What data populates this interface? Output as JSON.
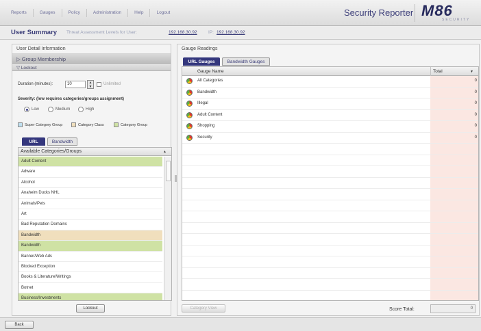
{
  "nav": {
    "items": [
      "Reports",
      "Gauges",
      "Policy",
      "Administration",
      "Help",
      "Logout"
    ],
    "brand": "Security Reporter",
    "logo_main": "M86",
    "logo_sub": "SECURITY"
  },
  "titlebar": {
    "title": "User Summary",
    "subtitle": "Threat Assessment Levels for User:",
    "user_ip": "192.168.30.92",
    "ip_label": "IP:",
    "ip": "192.168.30.92"
  },
  "left_panel": {
    "header": "User Detail Information",
    "group_membership": "Group Membership",
    "lockout": "Lockout",
    "duration_label": "Duration (minutes):",
    "duration_value": "10",
    "unlimited_label": "Unlimited",
    "severity_label": "Severity: (low requires categories/groups assignment)",
    "severity_options": [
      "Low",
      "Medium",
      "High"
    ],
    "severity_selected": "Low",
    "legend": [
      "Super Category Group",
      "Category Class",
      "Category Group"
    ],
    "legend_colors": [
      "#bfe0f0",
      "#f0dfbd",
      "#cfe2a4"
    ],
    "tabs": [
      "URL",
      "Bandwidth"
    ],
    "active_tab": "URL",
    "list_header": "Available Categories/Groups",
    "categories": [
      {
        "name": "Adult Content",
        "type": "group"
      },
      {
        "name": "Adware",
        "type": "none"
      },
      {
        "name": "Alcohol",
        "type": "none"
      },
      {
        "name": "Anaheim Ducks NHL",
        "type": "none"
      },
      {
        "name": "Animals/Pets",
        "type": "none"
      },
      {
        "name": "Art",
        "type": "none"
      },
      {
        "name": "Bad Reputation Domains",
        "type": "none"
      },
      {
        "name": "Bandwidth",
        "type": "class"
      },
      {
        "name": "Bandwidth",
        "type": "group"
      },
      {
        "name": "Banner/Web Ads",
        "type": "none"
      },
      {
        "name": "Blocked Exception",
        "type": "none"
      },
      {
        "name": "Books & Literature/Writings",
        "type": "none"
      },
      {
        "name": "Botnet",
        "type": "none"
      },
      {
        "name": "Business/Investments",
        "type": "group"
      }
    ],
    "lockout_button": "Lockout"
  },
  "right_panel": {
    "header": "Gauge Readings",
    "tabs": [
      "URL Gauges",
      "Bandwidth Gauges"
    ],
    "active_tab": "URL Gauges",
    "columns": [
      "Gauge Name",
      "Total"
    ],
    "rows": [
      {
        "name": "All Categories",
        "total": "0"
      },
      {
        "name": "Bandwidth",
        "total": "0"
      },
      {
        "name": "Illegal",
        "total": "0"
      },
      {
        "name": "Adult Content",
        "total": "0"
      },
      {
        "name": "Shopping",
        "total": "0"
      },
      {
        "name": "Security",
        "total": "0"
      }
    ],
    "category_view_button": "Category View",
    "score_label": "Score Total:",
    "score_value": "0"
  },
  "footer": {
    "back_button": "Back"
  }
}
